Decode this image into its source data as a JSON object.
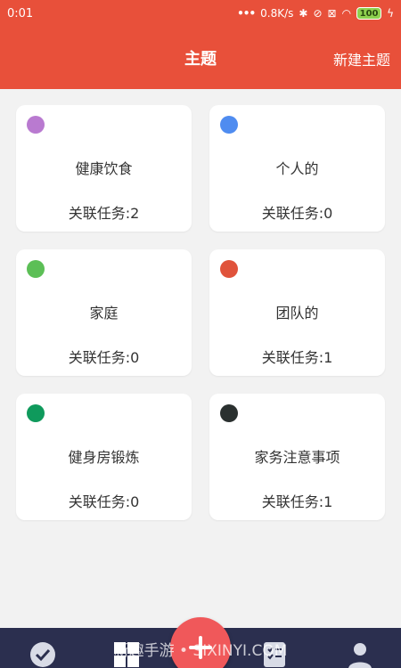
{
  "status_bar": {
    "time": "0:01",
    "network_speed": "0.8K/s",
    "battery": "100"
  },
  "header": {
    "title": "主题",
    "new_topic_label": "新建主题"
  },
  "topics": [
    {
      "name": "健康饮食",
      "count_label": "关联任务:2",
      "color": "#b97ad0"
    },
    {
      "name": "个人的",
      "count_label": "关联任务:0",
      "color": "#4f8cf0"
    },
    {
      "name": "家庭",
      "count_label": "关联任务:0",
      "color": "#5cbf56"
    },
    {
      "name": "团队的",
      "count_label": "关联任务:1",
      "color": "#e0533b"
    },
    {
      "name": "健身房锻炼",
      "count_label": "关联任务:0",
      "color": "#0f9a5c"
    },
    {
      "name": "家务注意事项",
      "count_label": "关联任务:1",
      "color": "#2a302f"
    }
  ],
  "watermark": "新趣手游 • SIXINYI.COM",
  "colors": {
    "header_bg": "#e8503a",
    "nav_bg": "#2b2f4f",
    "fab_bg": "#f0585a"
  },
  "icons": {
    "nav": [
      "check-circle-icon",
      "grid-icon",
      "checklist-icon",
      "user-icon"
    ],
    "fab": "plus-icon"
  }
}
